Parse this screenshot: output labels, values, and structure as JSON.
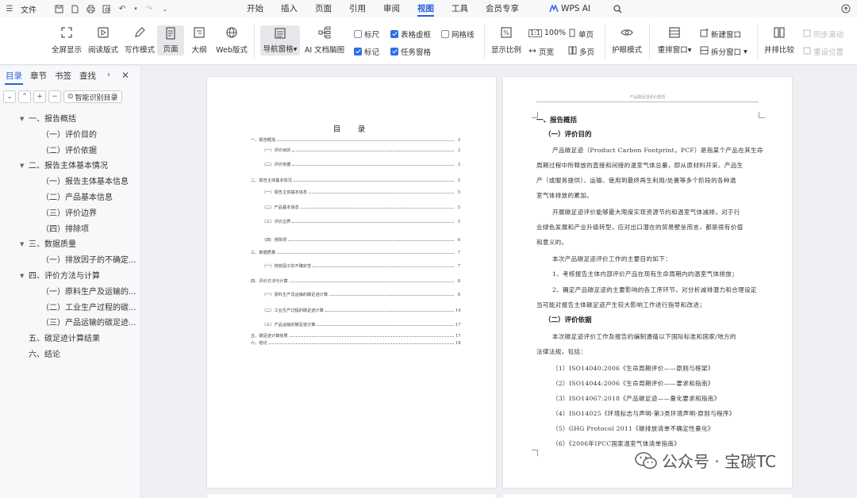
{
  "menubar": {
    "file_label": "文件",
    "tabs": [
      "开始",
      "插入",
      "页面",
      "引用",
      "审阅",
      "视图",
      "工具",
      "会员专享"
    ],
    "active_tab": "视图",
    "ai_label": "WPS AI"
  },
  "ribbon": {
    "fullscreen": "全屏显示",
    "reading_mode": "阅读版式",
    "writing_mode": "写作模式",
    "page_mode": "页面",
    "outline": "大纲",
    "web_layout": "Web版式",
    "nav_pane": "导航窗格",
    "ai_mindmap": "AI 文档脑图",
    "ruler": "标尺",
    "table_gridlines": "表格虚框",
    "gridlines": "网格线",
    "marks": "标记",
    "task_pane": "任务窗格",
    "show_ratio": "显示比例",
    "zoom_100": "100%",
    "page_width": "页宽",
    "single_page": "单页",
    "multi_page": "多页",
    "eye_mode": "护眼模式",
    "rearrange_windows": "重排窗口",
    "new_window": "新建窗口",
    "split_window": "拆分窗口",
    "side_by_side": "并排比较",
    "sync_scroll": "同步滚动",
    "reset_position": "重设位置"
  },
  "sidebar": {
    "tabs": [
      "目录",
      "章节",
      "书签",
      "查找"
    ],
    "active_tab": "目录",
    "smart_toc": "智能识别目录",
    "toc": [
      {
        "label": "一、报告概括",
        "level": 0,
        "expanded": true
      },
      {
        "label": "（一）评价目的",
        "level": 1
      },
      {
        "label": "（二）评价依据",
        "level": 1
      },
      {
        "label": "二、报告主体基本情况",
        "level": 0,
        "expanded": true
      },
      {
        "label": "（一）报告主体基本信息",
        "level": 1
      },
      {
        "label": "（二）产品基本信息",
        "level": 1
      },
      {
        "label": "（三）评价边界",
        "level": 1
      },
      {
        "label": "（四）排除项",
        "level": 1
      },
      {
        "label": "三、数据质量",
        "level": 0,
        "expanded": true
      },
      {
        "label": "（一）排放因子的不确定...",
        "level": 1
      },
      {
        "label": "四、评价方法与计算",
        "level": 0,
        "expanded": true
      },
      {
        "label": "（一）原料生产及运输的...",
        "level": 1
      },
      {
        "label": "（二）工业生产过程的碳...",
        "level": 1
      },
      {
        "label": "（三）产品运输的碳足迹...",
        "level": 1
      },
      {
        "label": "五、碳足迹计算结果",
        "level": 0
      },
      {
        "label": "六、结论",
        "level": 0
      }
    ]
  },
  "page1": {
    "title": "目　录",
    "rows": [
      {
        "t": "一、报告概括",
        "p": "3",
        "ind": 0
      },
      {
        "t": "（一）评价目的",
        "p": "3",
        "ind": 1
      },
      {
        "t": "（二）评价依据",
        "p": "3",
        "ind": 1
      },
      {
        "t": "二、报告主体基本情况",
        "p": "5",
        "ind": 0
      },
      {
        "t": "（一）报告主体基本信息",
        "p": "5",
        "ind": 1
      },
      {
        "t": "（二）产品基本信息",
        "p": "5",
        "ind": 1
      },
      {
        "t": "（三）评价边界",
        "p": "5",
        "ind": 1
      },
      {
        "t": "（四）排除项",
        "p": "6",
        "ind": 1
      },
      {
        "t": "三、数据质量",
        "p": "7",
        "ind": 0
      },
      {
        "t": "（一）排放因子的不确定性",
        "p": "7",
        "ind": 1
      },
      {
        "t": "四、评价方法与计算",
        "p": "8",
        "ind": 0
      },
      {
        "t": "（一）原料生产及运输的碳足迹计算",
        "p": "8",
        "ind": 1
      },
      {
        "t": "（二）工业生产过程的碳足迹计算",
        "p": "14",
        "ind": 1
      },
      {
        "t": "（三）产品运输的碳足迹计算",
        "p": "17",
        "ind": 1
      },
      {
        "t": "五、碳足迹计算结果",
        "p": "17",
        "ind": 0
      },
      {
        "t": "六、结论",
        "p": "18",
        "ind": 0
      }
    ]
  },
  "page2": {
    "header": "产品碳足迹评价报告",
    "lines": [
      {
        "t": "一、报告概括",
        "c": "h",
        "x": 42
      },
      {
        "t": "（一）评价目的",
        "c": "h",
        "x": 52
      },
      {
        "t": "产品碳足迹（Product Carbon Footprint，PCF）是指某个产品在其生命",
        "c": "s",
        "x": 62
      },
      {
        "t": "周期过程中所释放的直接和间接的温室气体总量，即从原材料开采、产品生",
        "c": "s",
        "x": 42
      },
      {
        "t": "产（或服务提供）、运输、使用到最终再生利用/处置等多个阶段的各种温",
        "c": "s",
        "x": 42
      },
      {
        "t": "室气体排放的累加。",
        "c": "s",
        "x": 42
      },
      {
        "t": "开展碳足迹评价能够最大限度实现资源节约和温室气体减排，对于行",
        "c": "s",
        "x": 62
      },
      {
        "t": "业绿色发展和产业升级转型，应对出口潜在的贸易壁垒而言，都是很有价值",
        "c": "s",
        "x": 42
      },
      {
        "t": "和意义的。",
        "c": "s",
        "x": 42
      },
      {
        "t": "本次产品碳足迹评价工作的主要目的如下：",
        "c": "s",
        "x": 62
      },
      {
        "t": "1、考核报告主体内部评价产品在现有生命周期内的温室气体排放；",
        "c": "s",
        "x": 62
      },
      {
        "t": "2、确定产品碳足迹的主要影响的各工序环节，对分析减排潜力和合理设定",
        "c": "s",
        "x": 62
      },
      {
        "t": "当可能对报告主体碳足迹产生较大影响工作进行指导和改进；",
        "c": "s",
        "x": 42
      },
      {
        "t": "（二）评价依据",
        "c": "h",
        "x": 52
      },
      {
        "t": "本次碳足迹评价工作及报告的编制遵循以下国际标准和国家/地方的",
        "c": "s",
        "x": 62
      },
      {
        "t": "法律法规，包括：",
        "c": "s",
        "x": 42
      },
      {
        "t": "（1）ISO14040:2006《生命周期评价——原则与框架》",
        "c": "s",
        "x": 62
      },
      {
        "t": "（2）ISO14044:2006《生命周期评价——要求和指南》",
        "c": "s",
        "x": 62
      },
      {
        "t": "（3）ISO14067:2018《产品碳足迹——量化要求和指南》",
        "c": "s",
        "x": 62
      },
      {
        "t": "（4）ISO14025《环境标志与声明-第3类环境声明-原则与程序》",
        "c": "s",
        "x": 62
      },
      {
        "t": "（5）GHG Protocol 2011《碳排放清单不确定性量化》",
        "c": "s",
        "x": 62
      },
      {
        "t": "（6）《2006年IPCC国家温室气体清单指南》",
        "c": "s",
        "x": 62
      }
    ]
  },
  "watermark": {
    "text": "公众号 · 宝碳TC"
  },
  "colors": {
    "accent": "#2b5fd9",
    "checkbox": "#2b6ee8",
    "panel": "#f7f8fa",
    "canvas": "#eef0f3"
  }
}
